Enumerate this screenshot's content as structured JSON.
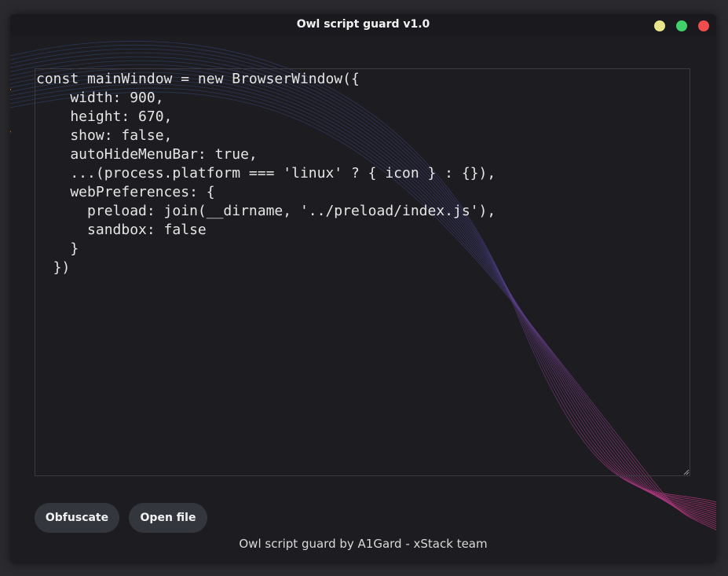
{
  "window": {
    "title": "Owl script guard v1.0",
    "controls": {
      "minimize_color": "#e8e58a",
      "maximize_color": "#3fd16b",
      "close_color": "#f04e4e"
    }
  },
  "editor": {
    "code": "const mainWindow = new BrowserWindow({\n    width: 900,\n    height: 670,\n    show: false,\n    autoHideMenuBar: true,\n    ...(process.platform === 'linux' ? { icon } : {}),\n    webPreferences: {\n      preload: join(__dirname, '../preload/index.js'),\n      sandbox: false\n    }\n  })"
  },
  "buttons": {
    "obfuscate_label": "Obfuscate",
    "open_file_label": "Open file"
  },
  "footer": {
    "text": "Owl script guard by A1Gard - xStack team"
  },
  "theme": {
    "background": "#1d1d21",
    "button_bg": "#33373d",
    "wave_blue": "#3a4a8a",
    "wave_pink": "#c0357a",
    "accent_orange": "#e36f1c"
  }
}
